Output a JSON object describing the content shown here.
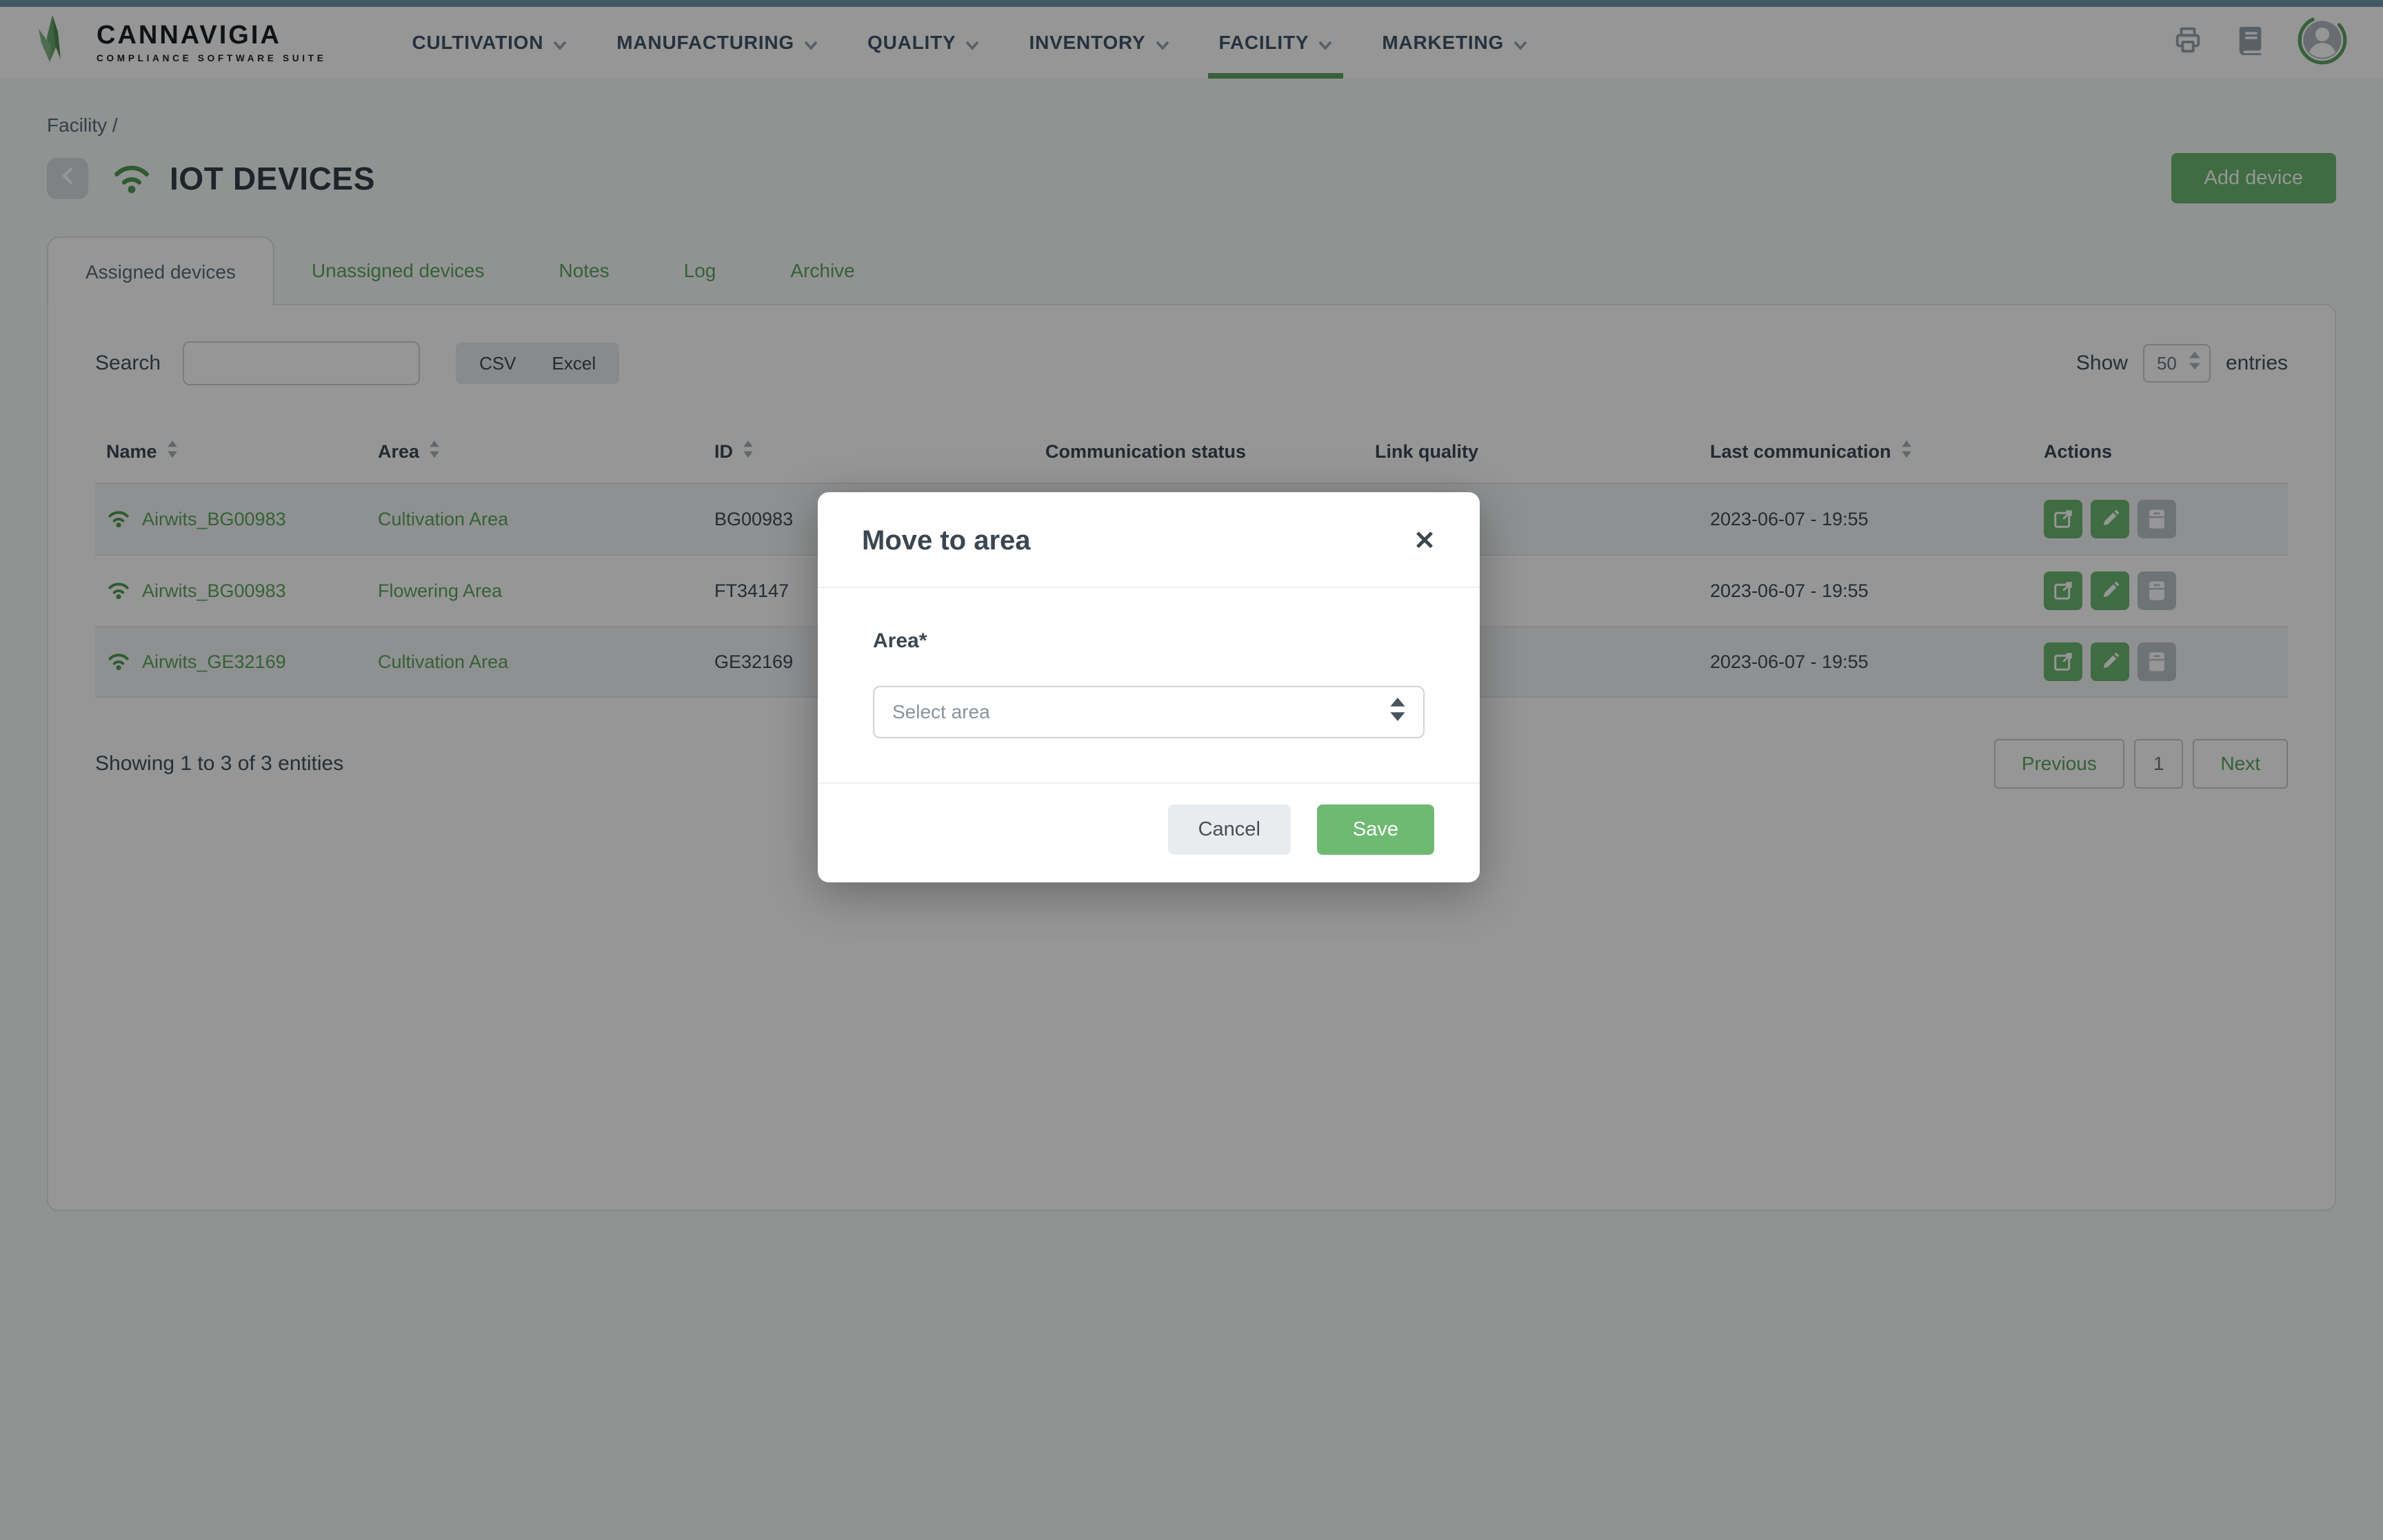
{
  "brand": {
    "name": "CANNAVIGIA",
    "tagline": "COMPLIANCE SOFTWARE SUITE"
  },
  "nav": {
    "items": [
      {
        "label": "CULTIVATION",
        "active": false
      },
      {
        "label": "MANUFACTURING",
        "active": false
      },
      {
        "label": "QUALITY",
        "active": false
      },
      {
        "label": "INVENTORY",
        "active": false
      },
      {
        "label": "FACILITY",
        "active": true
      },
      {
        "label": "MARKETING",
        "active": false
      }
    ]
  },
  "header": {
    "breadcrumb": "Facility /",
    "title": "IOT DEVICES",
    "add_button": "Add device"
  },
  "tabs": [
    {
      "label": "Assigned devices",
      "active": true
    },
    {
      "label": "Unassigned devices",
      "active": false
    },
    {
      "label": "Notes",
      "active": false
    },
    {
      "label": "Log",
      "active": false
    },
    {
      "label": "Archive",
      "active": false
    }
  ],
  "toolbar": {
    "search_label": "Search",
    "search_value": "",
    "export_buttons": [
      "CSV",
      "Excel"
    ],
    "show_label": "Show",
    "page_size": "50",
    "entries_label": "entries"
  },
  "table": {
    "columns": [
      {
        "label": "Name",
        "sortable": true
      },
      {
        "label": "Area",
        "sortable": true
      },
      {
        "label": "ID",
        "sortable": true
      },
      {
        "label": "Communication status",
        "sortable": false
      },
      {
        "label": "Link quality",
        "sortable": false
      },
      {
        "label": "Last communication",
        "sortable": true
      },
      {
        "label": "Actions",
        "sortable": false
      }
    ],
    "rows": [
      {
        "name": "Airwits_BG00983",
        "area": "Cultivation Area",
        "id": "BG00983",
        "communication_status": "",
        "link_quality": "",
        "last_communication": "2023-06-07 - 19:55"
      },
      {
        "name": "Airwits_BG00983",
        "area": "Flowering Area",
        "id": "FT34147",
        "communication_status": "",
        "link_quality": "",
        "last_communication": "2023-06-07 - 19:55"
      },
      {
        "name": "Airwits_GE32169",
        "area": "Cultivation Area",
        "id": "GE32169",
        "communication_status": "",
        "link_quality": "",
        "last_communication": "2023-06-07 - 19:55"
      }
    ]
  },
  "table_footer": {
    "showing_text": "Showing 1 to 3 of 3 entities",
    "pagination": {
      "previous": "Previous",
      "current_page": "1",
      "next": "Next"
    }
  },
  "modal": {
    "title": "Move to area",
    "close_icon": "✕",
    "area_label": "Area*",
    "select_placeholder": "Select area",
    "cancel_button": "Cancel",
    "save_button": "Save"
  },
  "colors": {
    "accent_green": "#6cb870",
    "link_green": "#5ba55e",
    "topbar_teal": "#6d9aab",
    "dark_text": "#3c4854"
  }
}
